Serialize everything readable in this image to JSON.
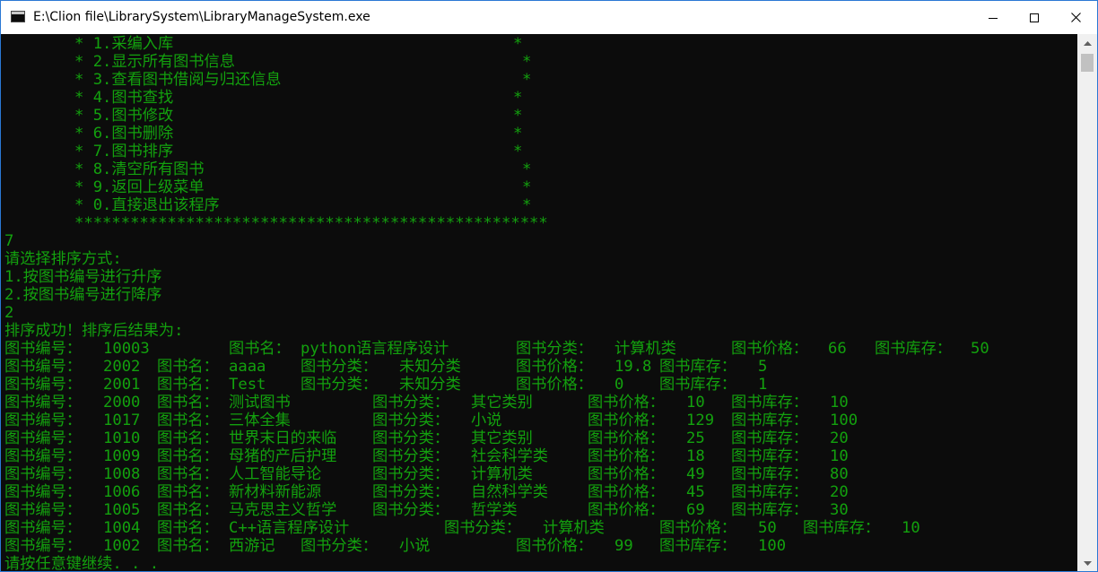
{
  "window": {
    "title": "E:\\Clion file\\LibrarySystem\\LibraryManageSystem.exe"
  },
  "menu": [
    {
      "text": "* 1.采编入库",
      "star": "*",
      "star_col": "a"
    },
    {
      "text": "* 2.显示所有图书信息",
      "star": "*",
      "star_col": "b"
    },
    {
      "text": "* 3.查看图书借阅与归还信息",
      "star": "*",
      "star_col": "b"
    },
    {
      "text": "* 4.图书查找",
      "star": "*",
      "star_col": "a"
    },
    {
      "text": "* 5.图书修改",
      "star": "*",
      "star_col": "a"
    },
    {
      "text": "* 6.图书删除",
      "star": "*",
      "star_col": "a"
    },
    {
      "text": "* 7.图书排序",
      "star": "*",
      "star_col": "a"
    },
    {
      "text": "* 8.清空所有图书",
      "star": "*",
      "star_col": "b"
    },
    {
      "text": "* 9.返回上级菜单",
      "star": "*",
      "star_col": "b"
    },
    {
      "text": "* 0.直接退出该程序",
      "star": "*",
      "star_col": "b"
    }
  ],
  "menu_border": "***************************************************",
  "prompt_lines": [
    "7",
    "请选择排序方式:",
    "1.按图书编号进行升序",
    "2.按图书编号进行降序",
    "2",
    "排序成功！排序后结果为:"
  ],
  "labels": {
    "id": "图书编号：",
    "name": "图书名：",
    "category": "图书分类：",
    "price": "图书价格：",
    "stock": "图书库存："
  },
  "books": [
    {
      "id": "10003",
      "name": "python语言程序设计",
      "category": "计算机类",
      "price": "66",
      "stock": "50"
    },
    {
      "id": "2002",
      "name": "aaaa",
      "category": "未知分类",
      "price": "19.8",
      "stock": "5"
    },
    {
      "id": "2001",
      "name": "Test",
      "category": "未知分类",
      "price": "0",
      "stock": "1"
    },
    {
      "id": "2000",
      "name": "测试图书",
      "category": "其它类别",
      "price": "10",
      "stock": "10"
    },
    {
      "id": "1017",
      "name": "三体全集",
      "category": "小说",
      "price": "129",
      "stock": "100"
    },
    {
      "id": "1010",
      "name": "世界末日的来临",
      "category": "其它类别",
      "price": "25",
      "stock": "20"
    },
    {
      "id": "1009",
      "name": "母猪的产后护理",
      "category": "社会科学类",
      "price": "18",
      "stock": "10"
    },
    {
      "id": "1008",
      "name": "人工智能导论",
      "category": "计算机类",
      "price": "49",
      "stock": "80"
    },
    {
      "id": "1006",
      "name": "新材料新能源",
      "category": "自然科学类",
      "price": "45",
      "stock": "20"
    },
    {
      "id": "1005",
      "name": "马克思主义哲学",
      "category": "哲学类",
      "price": "69",
      "stock": "30"
    },
    {
      "id": "1004",
      "name": "C++语言程序设计",
      "category": "计算机类",
      "price": "50",
      "stock": "10"
    },
    {
      "id": "1002",
      "name": "西游记",
      "category": "小说",
      "price": "99",
      "stock": "100"
    }
  ],
  "footer": "请按任意键继续. . .",
  "colors": {
    "console_text": "#13a10e",
    "console_bg": "#0c0c0c",
    "window_border": "#2b78d4"
  }
}
